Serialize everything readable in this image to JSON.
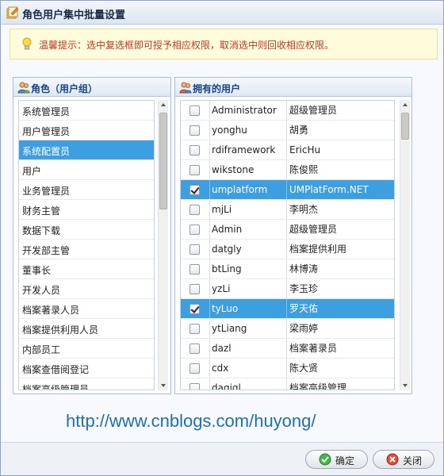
{
  "dialog": {
    "title": "角色用户集中批量设置"
  },
  "tip": {
    "text": "温馨提示：选中复选框即可授予相应权限，取消选中则回收相应权限。"
  },
  "left_panel": {
    "header": "角色（用户组）",
    "items": [
      {
        "label": "系统管理员",
        "selected": false
      },
      {
        "label": "用户管理员",
        "selected": false
      },
      {
        "label": "系统配置员",
        "selected": true
      },
      {
        "label": "用户",
        "selected": false
      },
      {
        "label": "业务管理员",
        "selected": false
      },
      {
        "label": "财务主管",
        "selected": false
      },
      {
        "label": "数据下载",
        "selected": false
      },
      {
        "label": "开发部主管",
        "selected": false
      },
      {
        "label": "董事长",
        "selected": false
      },
      {
        "label": "开发人员",
        "selected": false
      },
      {
        "label": "档案著录人员",
        "selected": false
      },
      {
        "label": "档案提供利用人员",
        "selected": false
      },
      {
        "label": "内部员工",
        "selected": false
      },
      {
        "label": "档案查借阅登记",
        "selected": false
      },
      {
        "label": "档案高级管理员",
        "selected": false
      }
    ]
  },
  "right_panel": {
    "header": "拥有的用户",
    "rows": [
      {
        "account": "Administrator",
        "name": "超级管理员",
        "checked": false,
        "selected": false
      },
      {
        "account": "yonghu",
        "name": "胡勇",
        "checked": false,
        "selected": false
      },
      {
        "account": "rdiframework",
        "name": "EricHu",
        "checked": false,
        "selected": false
      },
      {
        "account": "wikstone",
        "name": "陈俊熙",
        "checked": false,
        "selected": false
      },
      {
        "account": "umplatform",
        "name": "UMPlatForm.NET",
        "checked": true,
        "selected": true
      },
      {
        "account": "mjLi",
        "name": "李明杰",
        "checked": false,
        "selected": false
      },
      {
        "account": "Admin",
        "name": "超级管理员",
        "checked": false,
        "selected": false
      },
      {
        "account": "datgly",
        "name": "档案提供利用",
        "checked": false,
        "selected": false
      },
      {
        "account": "btLing",
        "name": "林博涛",
        "checked": false,
        "selected": false
      },
      {
        "account": "yzLi",
        "name": "李玉珍",
        "checked": false,
        "selected": false
      },
      {
        "account": "tyLuo",
        "name": "罗天佑",
        "checked": true,
        "selected": true
      },
      {
        "account": "ytLiang",
        "name": "梁雨婷",
        "checked": false,
        "selected": false
      },
      {
        "account": "dazl",
        "name": "档案著录员",
        "checked": false,
        "selected": false
      },
      {
        "account": "cdx",
        "name": "陈大贤",
        "checked": false,
        "selected": false
      },
      {
        "account": "dagjgl",
        "name": "档案高级管理",
        "checked": false,
        "selected": false
      }
    ]
  },
  "watermark": "http://www.cnblogs.com/huyong/",
  "buttons": {
    "ok": "确定",
    "close": "关闭"
  },
  "colors": {
    "selection": "#3d9ee0",
    "tip_text": "#c0392b",
    "tip_bg": "#fffbdb",
    "link": "#1f6fb2"
  }
}
